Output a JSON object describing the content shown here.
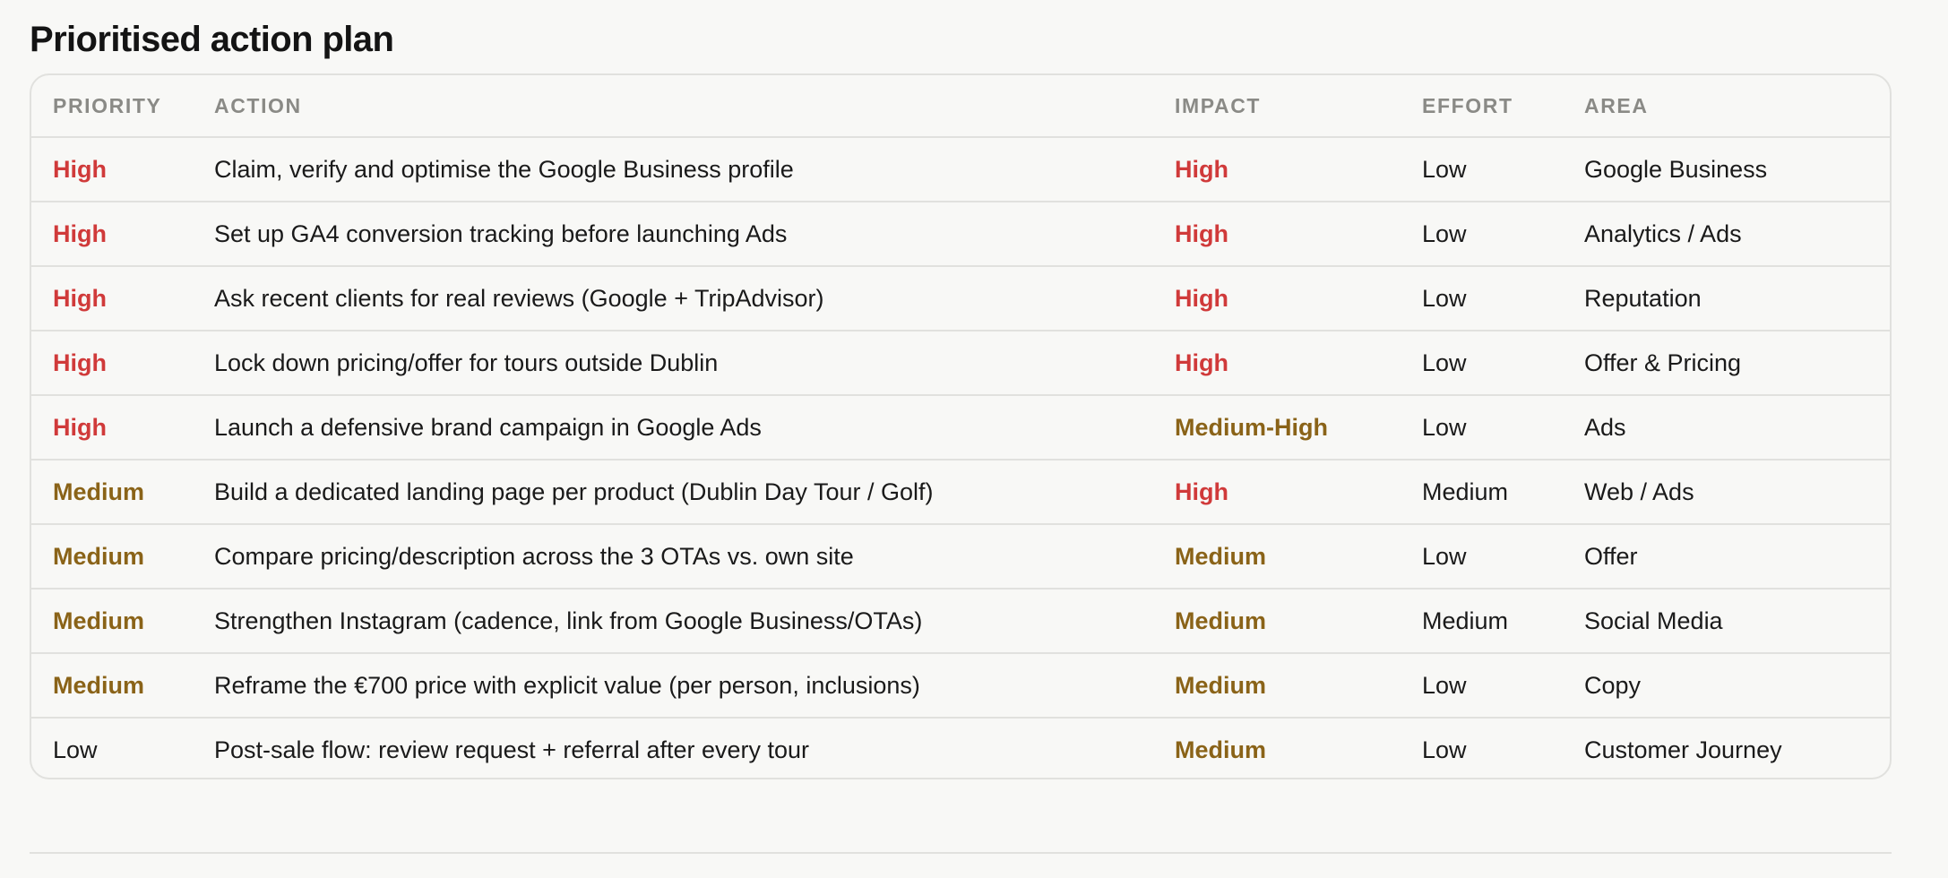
{
  "page": {
    "title": "Prioritised action plan"
  },
  "table": {
    "headers": {
      "priority": "PRIORITY",
      "action": "ACTION",
      "impact": "IMPACT",
      "effort": "EFFORT",
      "area": "AREA"
    },
    "rows": [
      {
        "priority": "High",
        "action": "Claim, verify and optimise the Google Business profile",
        "impact": "High",
        "effort": "Low",
        "area": "Google Business"
      },
      {
        "priority": "High",
        "action": "Set up GA4 conversion tracking before launching Ads",
        "impact": "High",
        "effort": "Low",
        "area": "Analytics / Ads"
      },
      {
        "priority": "High",
        "action": "Ask recent clients for real reviews (Google + TripAdvisor)",
        "impact": "High",
        "effort": "Low",
        "area": "Reputation"
      },
      {
        "priority": "High",
        "action": "Lock down pricing/offer for tours outside Dublin",
        "impact": "High",
        "effort": "Low",
        "area": "Offer & Pricing"
      },
      {
        "priority": "High",
        "action": "Launch a defensive brand campaign in Google Ads",
        "impact": "Medium-High",
        "effort": "Low",
        "area": "Ads"
      },
      {
        "priority": "Medium",
        "action": "Build a dedicated landing page per product (Dublin Day Tour / Golf)",
        "impact": "High",
        "effort": "Medium",
        "area": "Web / Ads"
      },
      {
        "priority": "Medium",
        "action": "Compare pricing/description across the 3 OTAs vs. own site",
        "impact": "Medium",
        "effort": "Low",
        "area": "Offer"
      },
      {
        "priority": "Medium",
        "action": "Strengthen Instagram (cadence, link from Google Business/OTAs)",
        "impact": "Medium",
        "effort": "Medium",
        "area": "Social Media"
      },
      {
        "priority": "Medium",
        "action": "Reframe the €700 price with explicit value (per person, inclusions)",
        "impact": "Medium",
        "effort": "Low",
        "area": "Copy"
      },
      {
        "priority": "Low",
        "action": "Post-sale flow: review request + referral after every tour",
        "impact": "Medium",
        "effort": "Low",
        "area": "Customer Journey"
      }
    ]
  },
  "colors": {
    "high": "#d03a3a",
    "medium": "#8a6318",
    "low": "#1a1a1a",
    "header_text": "#8a8a86",
    "border": "#e1e1de",
    "background": "#f8f8f6"
  }
}
